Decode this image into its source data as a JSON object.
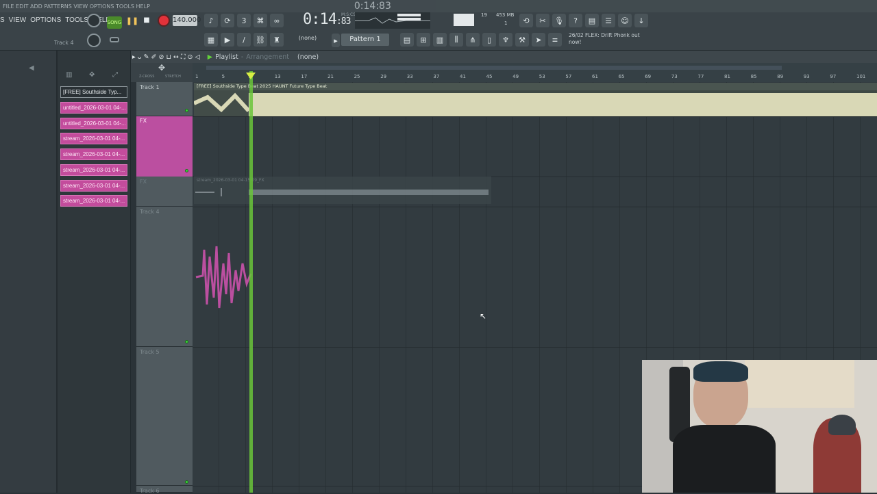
{
  "ghost_row": {
    "menu": "FILE EDIT ADD PATTERNS VIEW OPTIONS TOOLS HELP",
    "time": "0:14:83"
  },
  "menu": {
    "items": [
      "VIEW",
      "OPTIONS",
      "TOOLS",
      "HELP"
    ],
    "prefix": "S"
  },
  "transport": {
    "song_label": "SONG",
    "tempo": "140.000",
    "time_main": "0:14",
    "time_frac": ":83",
    "time_sub": "M:S:CS"
  },
  "cpu": {
    "voices": "19",
    "memory": "453 MB",
    "num": "1"
  },
  "hint": {
    "text": "26/02  FLEX: Drift Phonk out now!"
  },
  "pattern": {
    "none_label": "(none)",
    "name": "Pattern 1"
  },
  "track4_label": "Track 4",
  "playlist": {
    "title": "Playlist",
    "sep": "-",
    "sub": "Arrangement",
    "none": "(none)"
  },
  "ruler": {
    "numbers": [
      "1",
      "5",
      "9",
      "13",
      "17",
      "21",
      "25",
      "29",
      "33",
      "37",
      "41",
      "45",
      "49",
      "53",
      "57",
      "61",
      "65",
      "69",
      "73",
      "77",
      "81",
      "85",
      "89",
      "93",
      "97",
      "101"
    ]
  },
  "browser": {
    "items": [
      "[FREE] Southside Typ...",
      "untitled_2026-03-01 04-...",
      "untitled_2026-03-01 04-...",
      "stream_2026-03-01 04-...",
      "stream_2026-03-01 04-...",
      "stream_2026-03-01 04-...",
      "stream_2026-03-01 04-...",
      "stream_2026-03-01 04-..."
    ]
  },
  "tracks": [
    {
      "label": "Track 1"
    },
    {
      "label": "FX"
    },
    {
      "label": "FX"
    },
    {
      "label": "Track 4"
    },
    {
      "label": "Track 5"
    },
    {
      "label": "Track 6"
    }
  ],
  "clips": {
    "audio1": "[FREE] Southside Type Beat 2025 HAUNT Future Type Beat",
    "stream": "stream_2026-03-01 04-15-09_FX"
  },
  "colors": {
    "accent_pink": "#bb4fa0",
    "playhead": "#6ac63a",
    "record": "#e2323a",
    "audio_wave": "#d9d8b6"
  }
}
